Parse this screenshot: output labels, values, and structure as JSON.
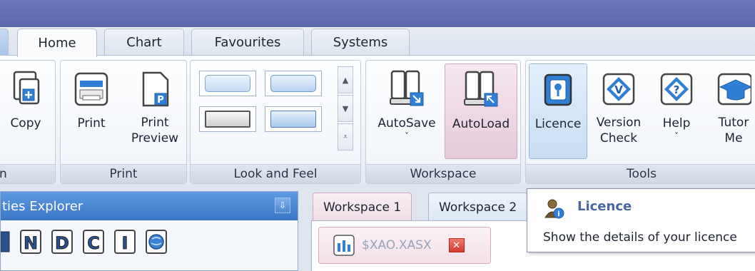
{
  "ribbon": {
    "tabs": [
      {
        "label": "Home"
      },
      {
        "label": "Chart"
      },
      {
        "label": "Favourites"
      },
      {
        "label": "Systems"
      }
    ],
    "groups": {
      "clipboard": {
        "label": "n",
        "copy_label": "Copy"
      },
      "print": {
        "label": "Print",
        "print_label": "Print",
        "preview_label": "Print\nPreview"
      },
      "look": {
        "label": "Look and Feel"
      },
      "workspace": {
        "label": "Workspace",
        "autosave_label": "AutoSave",
        "autoload_label": "AutoLoad"
      },
      "tools": {
        "label": "Tools",
        "licence_label": "Licence",
        "version_label": "Version\nCheck",
        "help_label": "Help",
        "tutor_label": "Tutor\nMe"
      }
    },
    "caret_glyph": "˅"
  },
  "explorer": {
    "title": "ties Explorer",
    "pin_glyph": "⇩",
    "tools": [
      "grid",
      "N",
      "D",
      "C",
      "I",
      "globe"
    ]
  },
  "workspace_tabs": [
    {
      "label": "Workspace 1"
    },
    {
      "label": "Workspace 2"
    }
  ],
  "document_tab": {
    "label": "$XAO.XASX",
    "close_glyph": "✕"
  },
  "tooltip": {
    "title": "Licence",
    "description": "Show the details of your licence"
  },
  "colors": {
    "title_band": "#6b76b8",
    "panel_header": "#3a76c6",
    "tooltip_title": "#4b65a6",
    "close_red": "#d33a2c"
  }
}
